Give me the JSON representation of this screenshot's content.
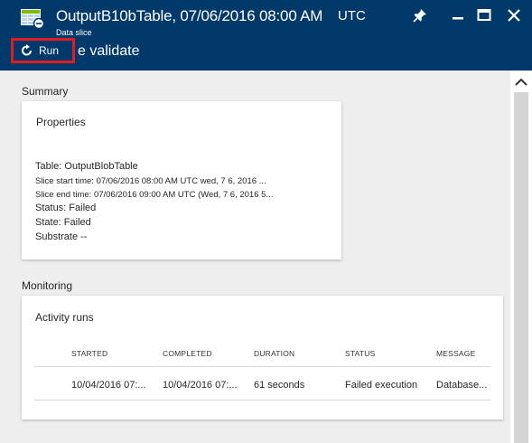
{
  "header": {
    "title": "OutputB10bTable, 07/06/2016 08:00 AM",
    "timezone": "UTC",
    "subtitle": "Data slice",
    "icon": "data-slice-table-icon",
    "background": "#01396b"
  },
  "window_controls": [
    "pin-icon",
    "minimize-icon",
    "maximize-icon",
    "close-icon"
  ],
  "commands": {
    "run_label": "Run",
    "validate_label": "e validate",
    "highlight_color": "#e01b22"
  },
  "summary": {
    "section_label": "Summary",
    "card_title": "Properties",
    "table": "Table: OutputBlobTable",
    "slice_start": "Slice start time: 07/06/2016 08:00 AM UTC wed, 7 6, 2016 ...",
    "slice_end": "Slice end time: 07/06/2016 09:00 AM UTC (Wed, 7 6, 2016 5...",
    "status": "Status: Failed",
    "state": "State: Failed",
    "substrate": "Substrate  --"
  },
  "monitoring": {
    "section_label": "Monitoring",
    "card_title": "Activity runs",
    "columns": [
      "STARTED",
      "COMPLETED",
      "DURATION",
      "STATUS",
      "MESSAGE"
    ],
    "rows": [
      [
        "10/04/2016 07:...",
        "10/04/2016 07:...",
        "61 seconds",
        "Failed execution",
        "Database..."
      ]
    ]
  }
}
